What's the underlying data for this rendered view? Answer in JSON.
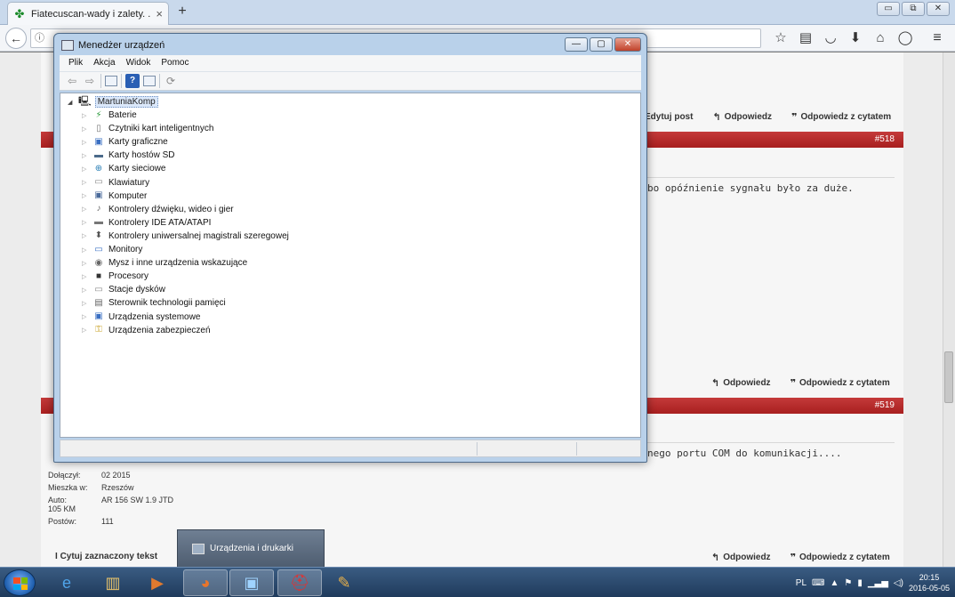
{
  "browser": {
    "tab_title": "Fiatecuscan-wady i zalety. ...",
    "tab_close": "×",
    "new_tab": "+",
    "window_buttons": [
      "▭",
      "⧉",
      "✕"
    ],
    "back": "←",
    "url_prefix": "ⓘ",
    "nav_icons": [
      "bookmark-star-icon",
      "reader-icon",
      "pocket-icon",
      "download-icon",
      "home-icon",
      "chat-icon"
    ],
    "nav_glyphs": [
      "☆",
      "▤",
      "◡",
      "⬇",
      "⌂",
      "◯"
    ],
    "menu": "≡"
  },
  "forum": {
    "post1_actions": {
      "edit": "Edytuj post",
      "reply": "Odpowiedz",
      "quote": "Odpowiedz z cytatem"
    },
    "post518_number": "#518",
    "post518_text": "bo opóźnienie sygnału było za duże.",
    "post518_actions": {
      "reply": "Odpowiedz",
      "quote": "Odpowiedz z cytatem"
    },
    "post519_number": "#519",
    "post519_text": "nego portu COM do komunikacji....",
    "post519_actions": {
      "reply": "Odpowiedz",
      "quote": "Odpowiedz z cytatem"
    },
    "user": {
      "joined_label": "Dołączył:",
      "joined_value": "02 2015",
      "city_label": "Mieszka w:",
      "city_value": "Rzeszów",
      "car_label": "Auto:",
      "car_value": "AR 156 SW 1.9 JTD",
      "car_sub": "105 KM",
      "posts_label": "Postów:",
      "posts_value": "111"
    },
    "quote_selected": "Cytuj zaznaczony tekst"
  },
  "device_manager": {
    "title": "Menedżer urządzeń",
    "menu": [
      "Plik",
      "Akcja",
      "Widok",
      "Pomoc"
    ],
    "root": "MartuniaKomp",
    "items": [
      "Baterie",
      "Czytniki kart inteligentnych",
      "Karty graficzne",
      "Karty hostów SD",
      "Karty sieciowe",
      "Klawiatury",
      "Komputer",
      "Kontrolery dźwięku, wideo i gier",
      "Kontrolery IDE ATA/ATAPI",
      "Kontrolery uniwersalnej magistrali szeregowej",
      "Monitory",
      "Mysz i inne urządzenia wskazujące",
      "Procesory",
      "Stacje dysków",
      "Sterownik technologii pamięci",
      "Urządzenia systemowe",
      "Urządzenia zabezpieczeń"
    ],
    "item_icons": [
      "battery-icon",
      "smartcard-reader-icon",
      "display-adapter-icon",
      "sd-host-icon",
      "network-adapter-icon",
      "keyboard-icon",
      "computer-icon",
      "sound-icon",
      "ide-icon",
      "usb-icon",
      "monitor-icon",
      "mouse-icon",
      "processor-icon",
      "disk-drive-icon",
      "memory-tech-icon",
      "system-devices-icon",
      "security-devices-icon"
    ],
    "item_glyphs": [
      "⚡",
      "▯",
      "▣",
      "▬",
      "⊕",
      "▭",
      "▣",
      "♪",
      "▬",
      "⬍",
      "▭",
      "◉",
      "■",
      "▭",
      "▤",
      "▣",
      "⚿"
    ],
    "win_min": "—",
    "win_max": "▢",
    "win_close": "✕"
  },
  "tooltip": {
    "text": "Urządzenia i drukarki"
  },
  "taskbar": {
    "apps": [
      "internet-explorer-icon",
      "file-explorer-icon",
      "media-player-icon",
      "firefox-icon",
      "device-manager-icon",
      "toolbox-icon",
      "paint-icon"
    ],
    "app_glyphs": [
      "e",
      "▥",
      "▶",
      "◕",
      "▣",
      "⛑",
      "✎"
    ],
    "lang": "PL",
    "time": "20:15",
    "date": "2016-05-05"
  }
}
